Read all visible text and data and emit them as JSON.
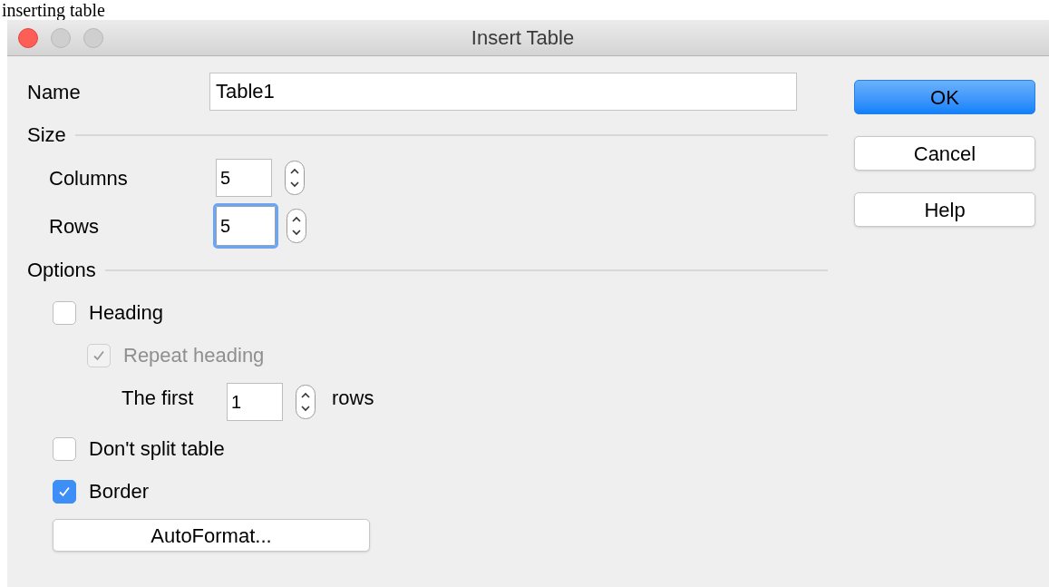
{
  "caption": "inserting table",
  "window": {
    "title": "Insert Table"
  },
  "name_field": {
    "label": "Name",
    "value": "Table1"
  },
  "size": {
    "title": "Size",
    "fields": [
      {
        "label": "Columns",
        "value": "5",
        "focused": false
      },
      {
        "label": "Rows",
        "value": "5",
        "focused": true
      }
    ]
  },
  "options": {
    "title": "Options",
    "items": [
      {
        "kind": "checkbox",
        "label": "Heading",
        "checked": false,
        "disabled": false,
        "children": [
          {
            "kind": "checkbox",
            "label": "Repeat heading",
            "checked": true,
            "disabled": true,
            "children": [
              {
                "kind": "spin",
                "label": "The first",
                "value": "1",
                "unit": "rows"
              }
            ]
          }
        ]
      },
      {
        "kind": "checkbox",
        "label": "Don't split table",
        "checked": false,
        "disabled": false
      },
      {
        "kind": "checkbox",
        "label": "Border",
        "checked": true,
        "disabled": false
      }
    ]
  },
  "autoformat_button": "AutoFormat...",
  "buttons": [
    {
      "label": "OK",
      "default": true
    },
    {
      "label": "Cancel",
      "default": false
    },
    {
      "label": "Help",
      "default": false
    }
  ]
}
